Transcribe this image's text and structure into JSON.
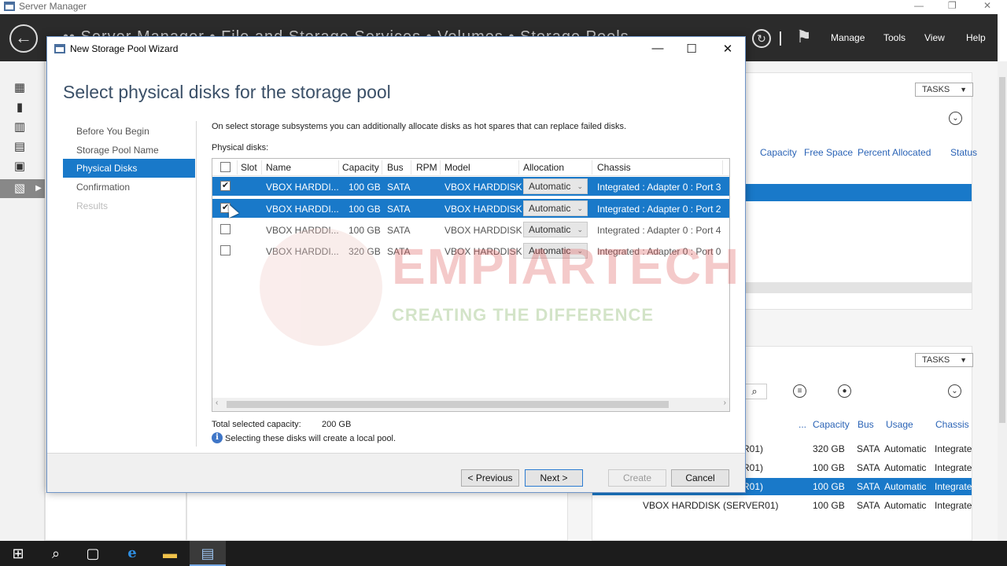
{
  "server_manager": {
    "title": "Server Manager",
    "breadcrumb": "•• Server Manager • File and Storage Services • Volumes • Storage Pools",
    "menu": [
      "Manage",
      "Tools",
      "View",
      "Help"
    ],
    "tasks_label": "TASKS",
    "pools_columns": [
      "Capacity",
      "Free Space",
      "Percent Allocated",
      "Status"
    ],
    "disks_columns": [
      "...",
      "Capacity",
      "Bus",
      "Usage",
      "Chassis"
    ],
    "disks_rows": [
      {
        "name": "R01)",
        "capacity": "320 GB",
        "bus": "SATA",
        "usage": "Automatic",
        "chassis": "Integrate"
      },
      {
        "name": "R01)",
        "capacity": "100 GB",
        "bus": "SATA",
        "usage": "Automatic",
        "chassis": "Integrate"
      },
      {
        "name": "R01)",
        "capacity": "100 GB",
        "bus": "SATA",
        "usage": "Automatic",
        "chassis": "Integrate"
      },
      {
        "name": "VBOX HARDDISK (SERVER01)",
        "capacity": "100 GB",
        "bus": "SATA",
        "usage": "Automatic",
        "chassis": "Integrate"
      }
    ]
  },
  "wizard": {
    "title": "New Storage Pool Wizard",
    "heading": "Select physical disks for the storage pool",
    "nav": [
      {
        "label": "Before You Begin",
        "state": "normal"
      },
      {
        "label": "Storage Pool Name",
        "state": "normal"
      },
      {
        "label": "Physical Disks",
        "state": "active"
      },
      {
        "label": "Confirmation",
        "state": "normal"
      },
      {
        "label": "Results",
        "state": "disabled"
      }
    ],
    "description": "On select storage subsystems you can additionally allocate disks as hot spares that can replace failed disks.",
    "disks_label": "Physical disks:",
    "columns": {
      "slot": "Slot",
      "name": "Name",
      "capacity": "Capacity",
      "bus": "Bus",
      "rpm": "RPM",
      "model": "Model",
      "allocation": "Allocation",
      "chassis": "Chassis"
    },
    "disks": [
      {
        "checked": true,
        "name": "VBOX HARDDI...",
        "capacity": "100 GB",
        "bus": "SATA",
        "model": "VBOX HARDDISK",
        "allocation": "Automatic",
        "chassis": "Integrated : Adapter 0 : Port 3"
      },
      {
        "checked": true,
        "name": "VBOX HARDDI...",
        "capacity": "100 GB",
        "bus": "SATA",
        "model": "VBOX HARDDISK",
        "allocation": "Automatic",
        "chassis": "Integrated : Adapter 0 : Port 2"
      },
      {
        "checked": false,
        "name": "VBOX HARDDI...",
        "capacity": "100 GB",
        "bus": "SATA",
        "model": "VBOX HARDDISK",
        "allocation": "Automatic",
        "chassis": "Integrated : Adapter 0 : Port 4"
      },
      {
        "checked": false,
        "name": "VBOX HARDDI...",
        "capacity": "320 GB",
        "bus": "SATA",
        "model": "VBOX HARDDISK",
        "allocation": "Automatic",
        "chassis": "Integrated : Adapter 0 : Port 0"
      }
    ],
    "total_label": "Total selected capacity:",
    "total_value": "200 GB",
    "info_text": "Selecting these disks will create a local pool.",
    "buttons": {
      "previous": "< Previous",
      "next": "Next >",
      "create": "Create",
      "cancel": "Cancel"
    }
  },
  "watermark": {
    "name": "EMPIARTECH",
    "tagline": "CREATING THE DIFFERENCE"
  },
  "colors": {
    "accent": "#1979c9",
    "header_bg": "#2b2b2b",
    "heading": "#3b5068"
  }
}
